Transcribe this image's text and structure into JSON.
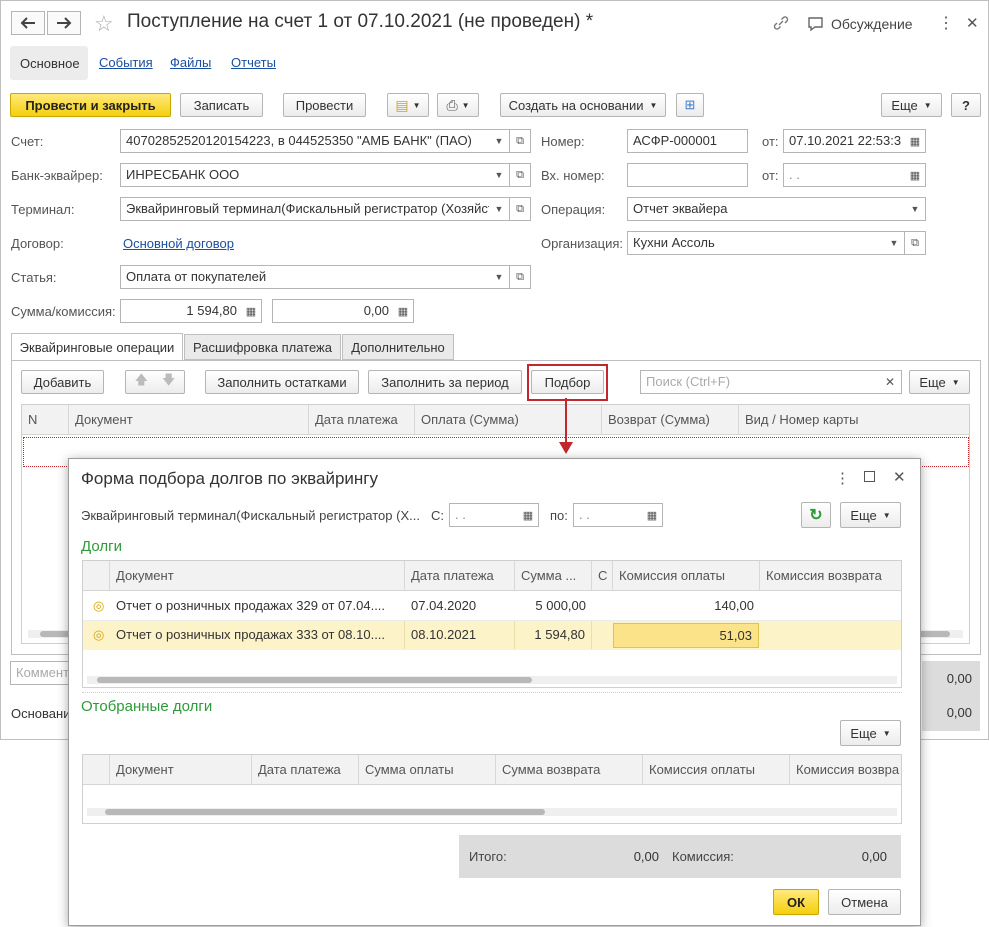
{
  "window": {
    "title": "Поступление на счет 1 от 07.10.2021 (не проведен) *",
    "discussion": "Обсуждение",
    "tabs": [
      "Основное",
      "События",
      "Файлы",
      "Отчеты"
    ]
  },
  "toolbar": {
    "post_close": "Провести и закрыть",
    "save": "Записать",
    "post": "Провести",
    "create_based": "Создать на основании",
    "more": "Еще",
    "help": "?"
  },
  "form": {
    "account_label": "Счет:",
    "account_value": "40702852520120154223, в 044525350 \"АМБ БАНК\" (ПАО)",
    "bank_label": "Банк-эквайрер:",
    "bank_value": "ИНРЕСБАНК ООО",
    "terminal_label": "Терминал:",
    "terminal_value": "Эквайринговый терминал(Фискальный регистратор (Хозяйст",
    "contract_label": "Договор:",
    "contract_value": "Основной договор",
    "article_label": "Статья:",
    "article_value": "Оплата от покупателей",
    "sum_label": "Сумма/комиссия:",
    "sum_value": "1 594,80",
    "commission_value": "0,00",
    "number_label": "Номер:",
    "number_value": "АСФР-000001",
    "from_label": "от:",
    "date_value": "07.10.2021 22:53:3",
    "in_number_label": "Вх. номер:",
    "in_date_placeholder": " .  .",
    "operation_label": "Операция:",
    "operation_value": "Отчет эквайера",
    "org_label": "Организация:",
    "org_value": "Кухни Ассоль"
  },
  "subtabs": [
    "Эквайринговые операции",
    "Расшифровка платежа",
    "Дополнительно"
  ],
  "subtoolbar": {
    "add": "Добавить",
    "fill_rest": "Заполнить остатками",
    "fill_period": "Заполнить за период",
    "pick": "Подбор",
    "search_placeholder": "Поиск (Ctrl+F)",
    "more": "Еще"
  },
  "main_grid": {
    "columns": [
      "N",
      "Документ",
      "Дата платежа",
      "Оплата (Сумма)",
      "Возврат (Сумма)",
      "Вид / Номер карты"
    ]
  },
  "bottom": {
    "comment_placeholder": "Коммента",
    "basis_label": "Основани",
    "total1": "0,00",
    "total2": "0,00"
  },
  "modal": {
    "title": "Форма подбора долгов по эквайрингу",
    "terminal": "Эквайринговый терминал(Фискальный регистратор (Х...",
    "from_label": "С:",
    "to_label": "по:",
    "date_placeholder": " .  .",
    "more": "Еще",
    "debts_header": "Долги",
    "debts_columns": [
      "Документ",
      "Дата платежа",
      "Сумма ...",
      "С",
      "Комиссия оплаты",
      "Комиссия возврата"
    ],
    "debts_rows": [
      {
        "doc": "Отчет о розничных продажах 329 от 07.04....",
        "date": "07.04.2020",
        "sum": "5 000,00",
        "commission": "140,00"
      },
      {
        "doc": "Отчет о розничных продажах 333 от 08.10....",
        "date": "08.10.2021",
        "sum": "1 594,80",
        "commission": "51,03"
      }
    ],
    "selected_header": "Отобранные долги",
    "selected_more": "Еще",
    "selected_columns": [
      "Документ",
      "Дата платежа",
      "Сумма оплаты",
      "Сумма возврата",
      "Комиссия оплаты",
      "Комиссия возвра"
    ],
    "total_label": "Итого:",
    "total_value": "0,00",
    "commission_label": "Комиссия:",
    "commission_value": "0,00",
    "ok": "ОК",
    "cancel": "Отмена"
  }
}
